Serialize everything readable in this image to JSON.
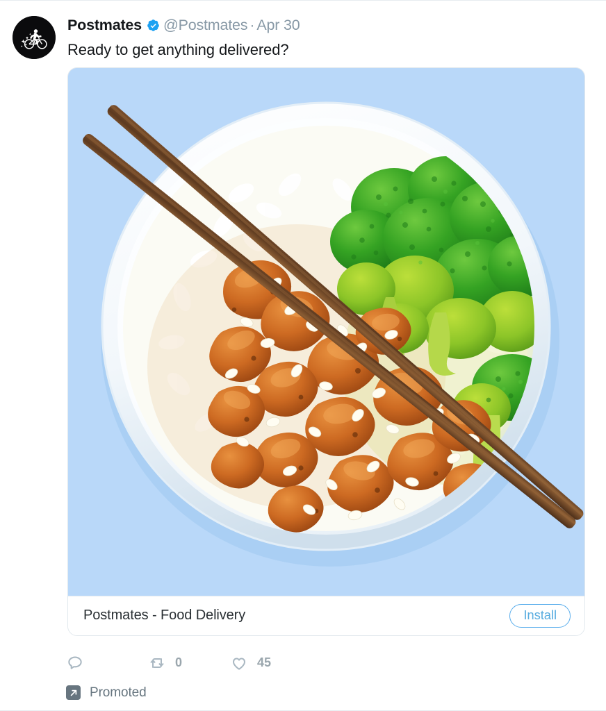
{
  "tweet": {
    "author": {
      "display_name": "Postmates",
      "handle": "@Postmates",
      "verified": true,
      "avatar_icon": "postmates-cyclist-logo",
      "avatar_background": "#0b0b0d"
    },
    "separator": "·",
    "date": "Apr 30",
    "text": "Ready to get anything delivered?",
    "media": {
      "alt": "Bowl of teriyaki chicken with broccoli and white rice, wooden chopsticks on light blue background",
      "background_color": "#b9d8f9",
      "bowl_color": "#ffffff",
      "rice_color": "#f7f7f2",
      "broccoli_color": "#3faa2c",
      "chicken_color": "#c75d1c",
      "chopstick_color": "#6b4425"
    },
    "app_card": {
      "title": "Postmates - Food Delivery",
      "install_label": "Install",
      "install_color": "#59adec"
    },
    "actions": {
      "reply": {
        "icon": "reply-icon",
        "count": ""
      },
      "retweet": {
        "icon": "retweet-icon",
        "count": "0"
      },
      "like": {
        "icon": "heart-icon",
        "count": "45"
      }
    },
    "promoted": {
      "icon": "promoted-arrow-icon",
      "label": "Promoted"
    }
  }
}
